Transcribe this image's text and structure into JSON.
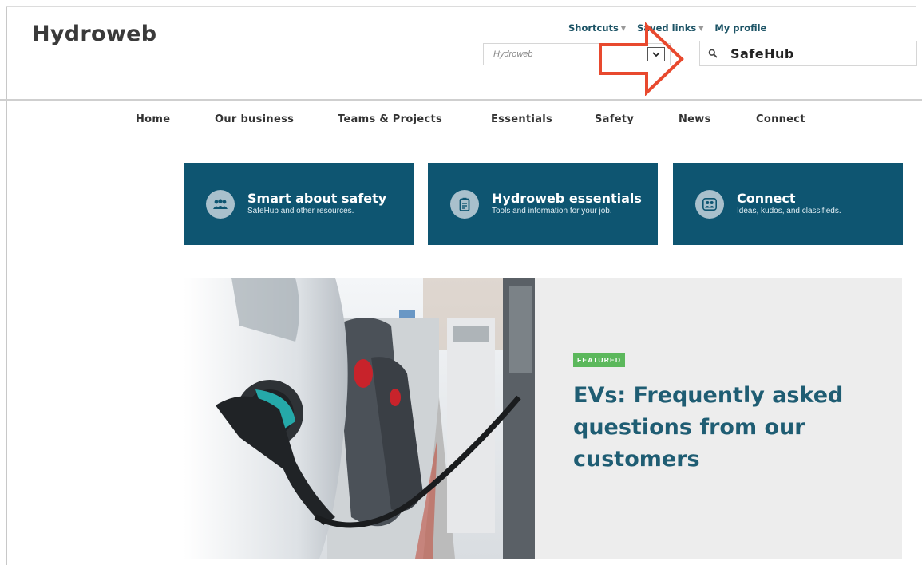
{
  "header": {
    "logo": "Hydroweb",
    "top_links": [
      {
        "label": "Shortcuts",
        "has_caret": true
      },
      {
        "label": "Saved links",
        "has_caret": true
      },
      {
        "label": "My profile",
        "has_caret": false
      }
    ],
    "scope_select": {
      "value": "Hydroweb",
      "icon": "chevron-down-icon"
    },
    "search": {
      "value": "SafeHub",
      "icon": "search-icon"
    }
  },
  "annotation": {
    "shape": "arrow-right",
    "color": "#e8492e"
  },
  "nav": {
    "items": [
      "Home",
      "Our business",
      "Teams & Projects",
      "Essentials",
      "Safety",
      "News",
      "Connect"
    ]
  },
  "tiles": [
    {
      "title": "Smart about safety",
      "subtitle": "SafeHub and other resources.",
      "icon": "people-group-icon"
    },
    {
      "title": "Hydroweb essentials",
      "subtitle": "Tools and information for your job.",
      "icon": "clipboard-icon"
    },
    {
      "title": "Connect",
      "subtitle": "Ideas, kudos, and classifieds.",
      "icon": "users-icon"
    }
  ],
  "featured": {
    "badge": "FEATURED",
    "title": "EVs: Frequently asked questions from our customers",
    "image_subject": "electric car charging at street charger"
  },
  "colors": {
    "brand_teal": "#0e5571",
    "link_teal": "#1d5466",
    "featured_title": "#1f5d73",
    "badge_green": "#5cb85c",
    "feature_bg": "#ededed",
    "annotation_orange": "#e8492e"
  }
}
